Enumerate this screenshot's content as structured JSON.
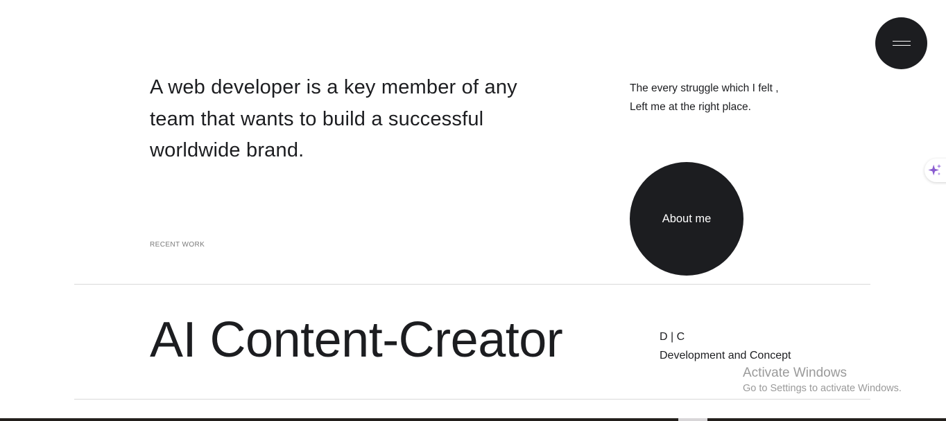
{
  "header": {
    "menu_icon": "hamburger-icon"
  },
  "intro": {
    "text": "A web developer is a key member of any team that wants to build a successful worldwide brand.",
    "side_line_1": "The every struggle which I felt ,",
    "side_line_2": "Left me at the right place.",
    "about_button_label": "About me"
  },
  "assistant": {
    "icon": "sparkles-icon",
    "accent": "#8a5cd0"
  },
  "work": {
    "section_label": "RECENT WORK",
    "projects": [
      {
        "title": "AI Content-Creator",
        "short_tag": "D | C",
        "category": "Development and Concept"
      }
    ]
  },
  "os_overlay": {
    "title": "Activate Windows",
    "subtitle": "Go to Settings to activate Windows."
  },
  "colors": {
    "dark": "#1c1d20",
    "background": "#ffffff",
    "muted": "#7a7a7a",
    "divider": "#d9d9d9"
  }
}
